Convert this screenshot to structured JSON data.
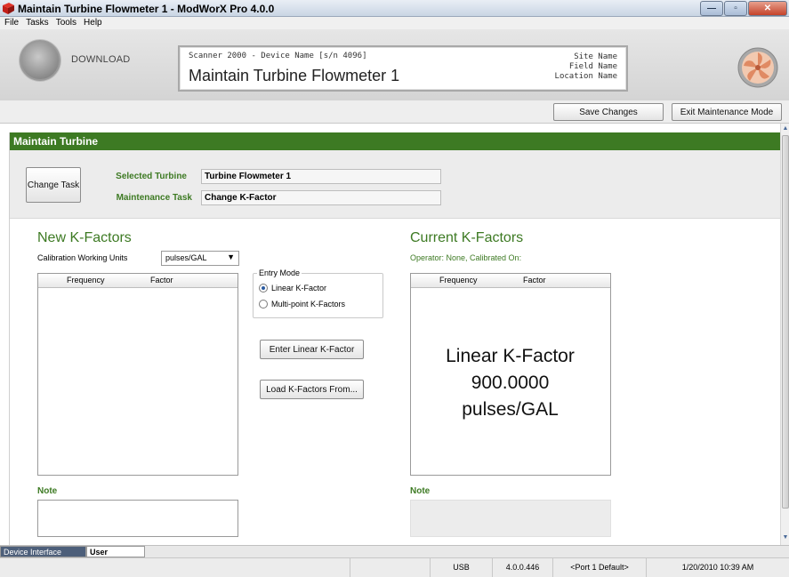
{
  "window": {
    "title": "Maintain Turbine Flowmeter 1 - ModWorX Pro 4.0.0",
    "min_glyph": "—",
    "max_glyph": "▫",
    "close_glyph": "✕"
  },
  "menu": [
    "File",
    "Tasks",
    "Tools",
    "Help"
  ],
  "header": {
    "download_label": "DOWNLOAD",
    "device_line": "Scanner 2000 - Device Name [s/n 4096]",
    "device_title": "Maintain Turbine Flowmeter 1",
    "site_name": "Site Name",
    "field_name": "Field Name",
    "location_name": "Location Name"
  },
  "toolbar": {
    "save_label": "Save Changes",
    "exit_label": "Exit Maintenance Mode"
  },
  "section": {
    "title": "Maintain Turbine"
  },
  "task": {
    "change_task_label": "Change Task",
    "selected_turbine_label": "Selected Turbine",
    "selected_turbine_value": "Turbine Flowmeter 1",
    "maintenance_task_label": "Maintenance Task",
    "maintenance_task_value": "Change K-Factor"
  },
  "new_kfactors": {
    "heading": "New K-Factors",
    "units_label": "Calibration Working Units",
    "units_value": "pulses/GAL",
    "columns": [
      "Frequency",
      "Factor"
    ],
    "rows": [],
    "note_label": "Note",
    "note_value": ""
  },
  "entry_mode": {
    "legend": "Entry Mode",
    "options": [
      {
        "label": "Linear K-Factor",
        "selected": true
      },
      {
        "label": "Multi-point K-Factors",
        "selected": false
      }
    ],
    "enter_button": "Enter Linear K-Factor",
    "load_button": "Load K-Factors From..."
  },
  "current_kfactors": {
    "heading": "Current K-Factors",
    "operator_line": "Operator: None, Calibrated On:",
    "columns": [
      "Frequency",
      "Factor"
    ],
    "overlay_line1": "Linear K-Factor",
    "overlay_line2": "900.0000",
    "overlay_line3": "pulses/GAL",
    "note_label": "Note"
  },
  "tabs": {
    "device_interface": "Device Interface",
    "user_manuals": "User Manuals"
  },
  "status": {
    "connection": "USB",
    "version": "4.0.0.446",
    "port": "<Port 1 Default>",
    "datetime": "1/20/2010 10:39 AM"
  },
  "colors": {
    "accent_green": "#3d7a23",
    "tab_active": "#4d5f7a"
  }
}
